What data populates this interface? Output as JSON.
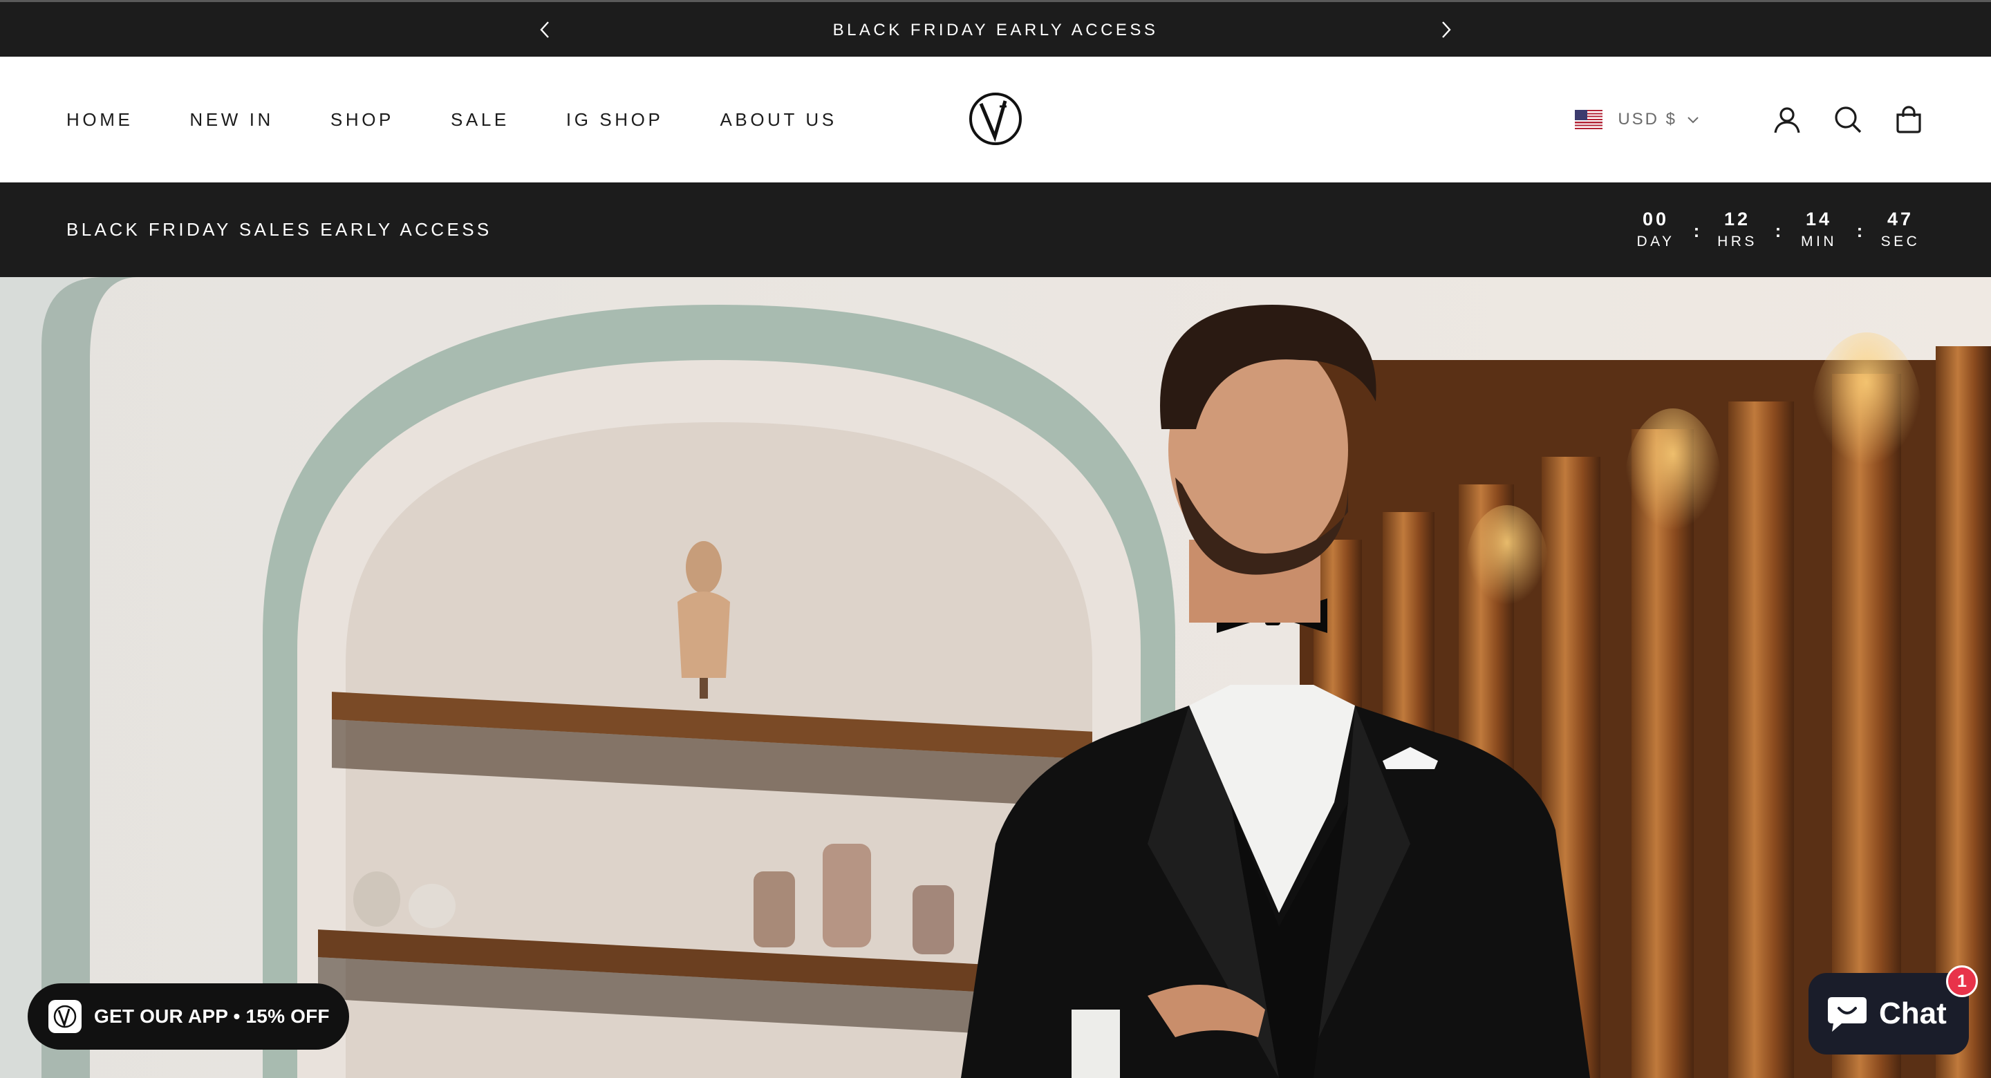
{
  "announcement": {
    "text": "BLACK FRIDAY EARLY ACCESS",
    "prev_icon": "chevron-left-icon",
    "next_icon": "chevron-right-icon"
  },
  "nav": {
    "items": [
      "HOME",
      "NEW IN",
      "SHOP",
      "SALE",
      "IG SHOP",
      "ABOUT US"
    ]
  },
  "logo": {
    "icon": "brand-v-logo"
  },
  "header_right": {
    "currency": "USD $",
    "currency_flag": "us-flag-icon",
    "icons": [
      "account-icon",
      "search-icon",
      "cart-icon"
    ]
  },
  "countdown": {
    "title": "BLACK FRIDAY SALES EARLY ACCESS",
    "units": [
      {
        "value": "00",
        "label": "DAY"
      },
      {
        "value": "12",
        "label": "HRS"
      },
      {
        "value": "14",
        "label": "MIN"
      },
      {
        "value": "47",
        "label": "SEC"
      }
    ],
    "separator": ":"
  },
  "app_banner": {
    "text": "GET OUR APP • 15% OFF"
  },
  "chat": {
    "label": "Chat",
    "badge": "1"
  },
  "colors": {
    "bar_bg": "#1c1c1c",
    "text_dark": "#1c1c1c",
    "chat_bg": "#1a1d2a",
    "badge": "#e8334a"
  }
}
